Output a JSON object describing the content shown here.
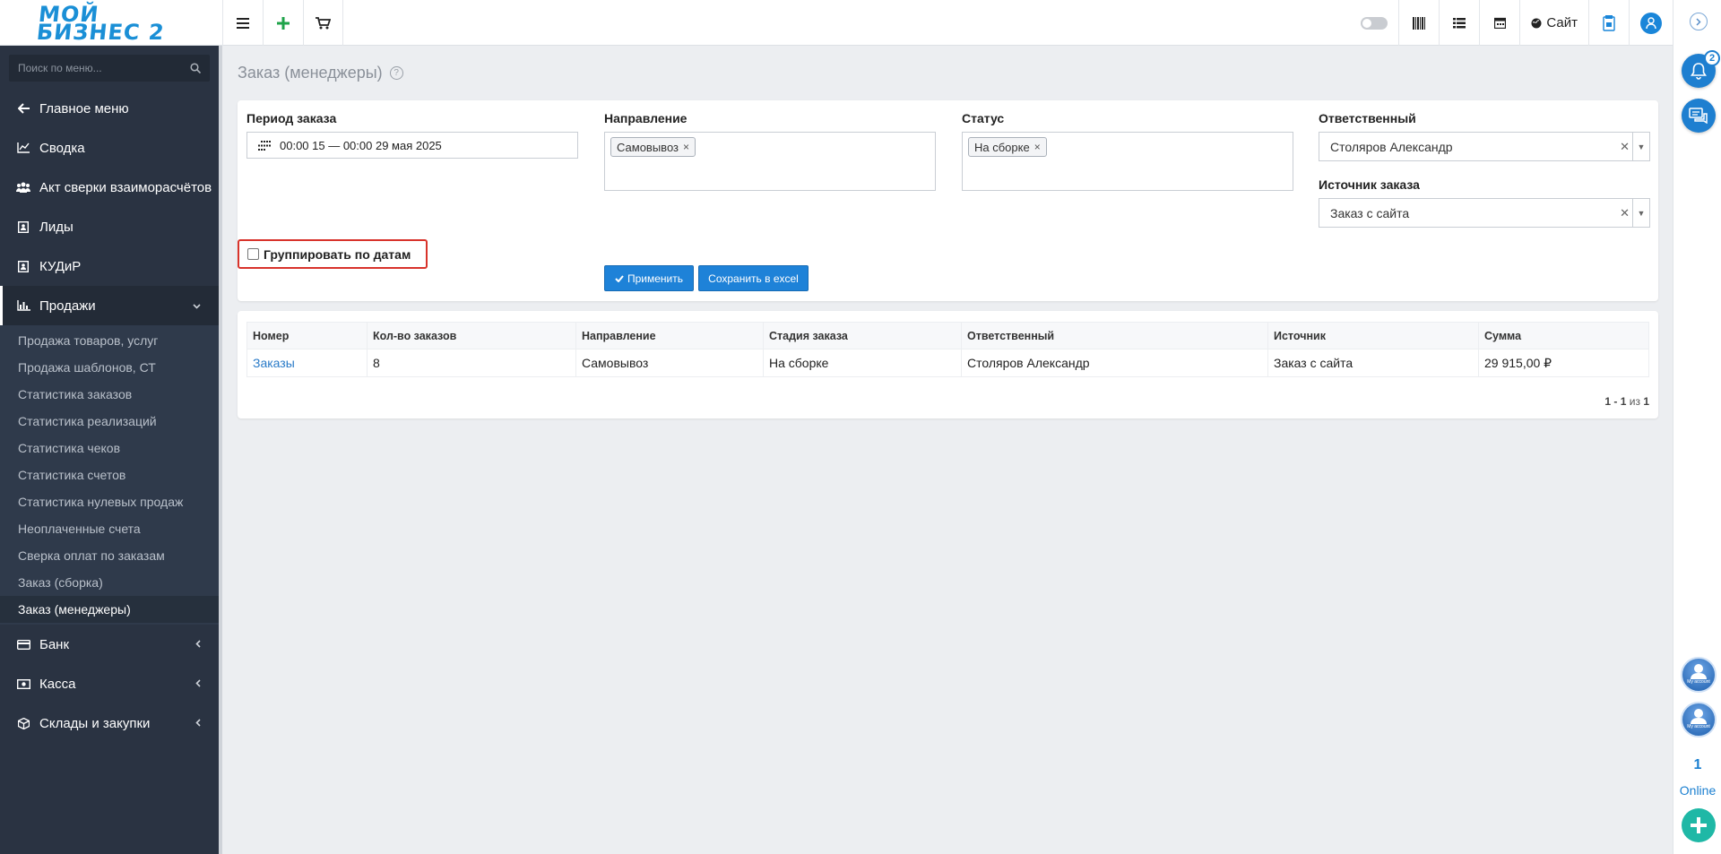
{
  "header": {
    "logo_line1": "МОЙ",
    "logo_line2": "БИЗНЕС 2",
    "site_label": "Сайт"
  },
  "sidebar": {
    "search_placeholder": "Поиск по меню...",
    "items": [
      {
        "label": "Главное меню",
        "icon": "arrow-left-icon"
      },
      {
        "label": "Сводка",
        "icon": "chart-line-icon"
      },
      {
        "label": "Акт сверки взаиморасчётов",
        "icon": "users-icon"
      },
      {
        "label": "Лиды",
        "icon": "contact-card-icon"
      },
      {
        "label": "КУДиР",
        "icon": "contact-card-icon"
      },
      {
        "label": "Продажи",
        "icon": "bar-chart-icon"
      }
    ],
    "sales_submenu": [
      "Продажа товаров, услуг",
      "Продажа шаблонов, СТ",
      "Статистика заказов",
      "Статистика реализаций",
      "Статистика чеков",
      "Статистика счетов",
      "Статистика нулевых продаж",
      "Неоплаченные счета",
      "Сверка оплат по заказам",
      "Заказ (сборка)",
      "Заказ (менеджеры)"
    ],
    "bottom_items": [
      {
        "label": "Банк",
        "icon": "credit-card-icon"
      },
      {
        "label": "Касса",
        "icon": "cash-icon"
      },
      {
        "label": "Склады и закупки",
        "icon": "box-icon"
      }
    ]
  },
  "page": {
    "title": "Заказ (менеджеры)"
  },
  "filters": {
    "period_label": "Период заказа",
    "period_value": "00:00 15 — 00:00 29 мая 2025",
    "direction_label": "Направление",
    "direction_tag": "Самовывоз",
    "status_label": "Статус",
    "status_tag": "На сборке",
    "responsible_label": "Ответственный",
    "responsible_value": "Столяров Александр",
    "source_label": "Источник заказа",
    "source_value": "Заказ с сайта",
    "group_by_dates_label": "Группировать по датам",
    "apply_label": "Применить",
    "excel_label": "Сохранить в excel"
  },
  "table": {
    "columns": [
      "Номер",
      "Кол-во заказов",
      "Направление",
      "Стадия заказа",
      "Ответственный",
      "Источник",
      "Сумма"
    ],
    "rows": [
      [
        "Заказы",
        "8",
        "Самовывоз",
        "На сборке",
        "Столяров Александр",
        "Заказ с сайта",
        "29 915,00 ₽"
      ]
    ],
    "pager_range": "1 - 1",
    "pager_of": "из",
    "pager_total": "1"
  },
  "rightbar": {
    "notifications_count": "2",
    "account_label": "My account",
    "online_count": "1",
    "online_label": "Online"
  }
}
